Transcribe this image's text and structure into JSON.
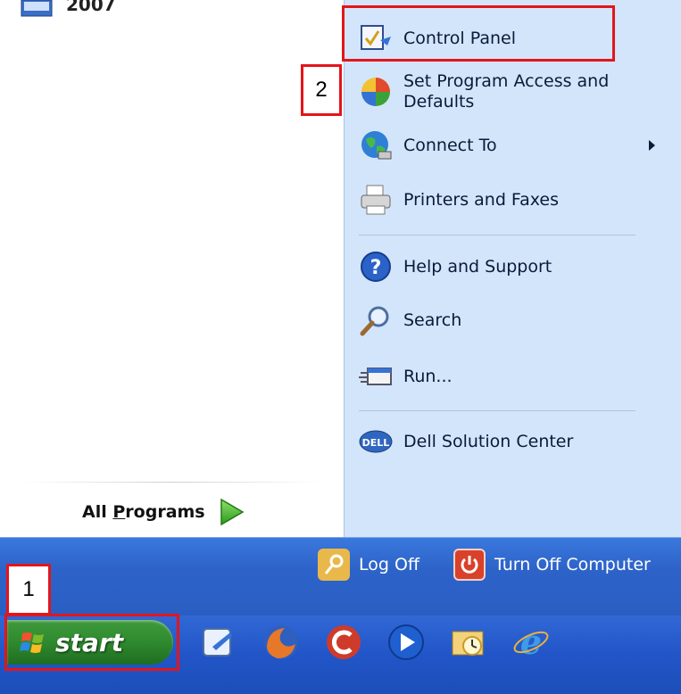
{
  "left_pane": {
    "top_item_label": "2007",
    "all_programs_label_prefix": "All ",
    "all_programs_label_underline": "P",
    "all_programs_label_suffix": "rograms"
  },
  "right_pane": {
    "items": [
      {
        "label": "Control Panel",
        "icon": "control-panel-icon"
      },
      {
        "label": "Set Program Access and Defaults",
        "icon": "program-access-icon"
      },
      {
        "label": "Connect To",
        "icon": "connect-to-icon",
        "has_submenu": true
      },
      {
        "label": "Printers and Faxes",
        "icon": "printer-icon"
      },
      {
        "label": "Help and Support",
        "icon": "help-icon"
      },
      {
        "label": "Search",
        "icon": "search-icon"
      },
      {
        "label": "Run...",
        "icon": "run-icon"
      },
      {
        "label": "Dell Solution Center",
        "icon": "dell-icon"
      }
    ]
  },
  "strip": {
    "log_off_label": "Log Off",
    "turn_off_label": "Turn Off Computer"
  },
  "taskbar": {
    "start_label": "start",
    "quick_launch": [
      "show-desktop-icon",
      "firefox-icon",
      "ccleaner-icon",
      "media-player-icon",
      "outlook-icon",
      "internet-explorer-icon"
    ]
  },
  "annotations": {
    "label_1": "1",
    "label_2": "2"
  },
  "colors": {
    "right_pane_bg": "#d3e5fa",
    "taskbar_blue": "#2255c8",
    "start_green": "#2f8a2f",
    "annotation_red": "#e3151b"
  }
}
